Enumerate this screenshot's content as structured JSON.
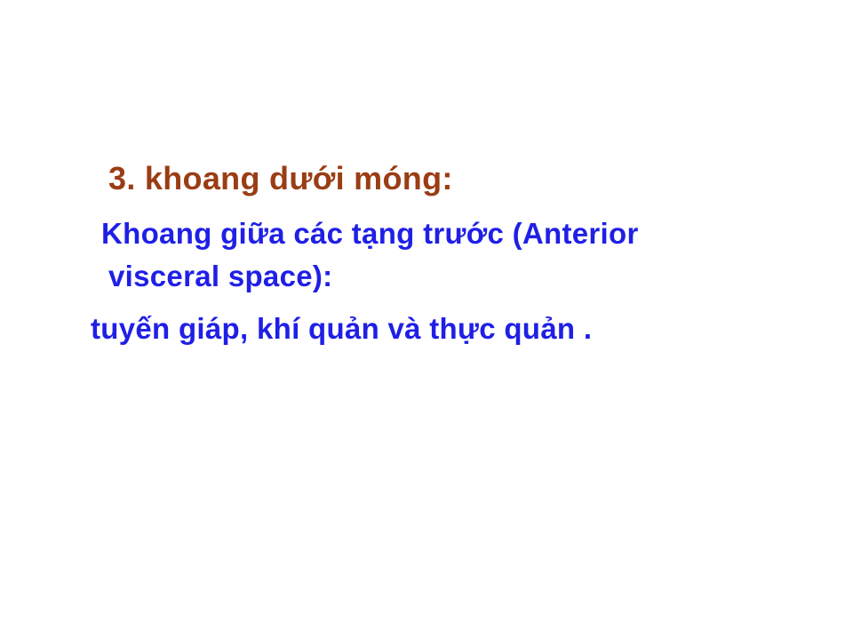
{
  "slide": {
    "heading": "3. khoang dưới móng:",
    "lines": [
      "Khoang giữa các tạng trước (Anterior",
      "visceral space):",
      "tuyến giáp, khí quản và thực quản ."
    ]
  },
  "colors": {
    "heading": "#9a3d14",
    "body": "#1f1fe6",
    "background": "#ffffff"
  }
}
